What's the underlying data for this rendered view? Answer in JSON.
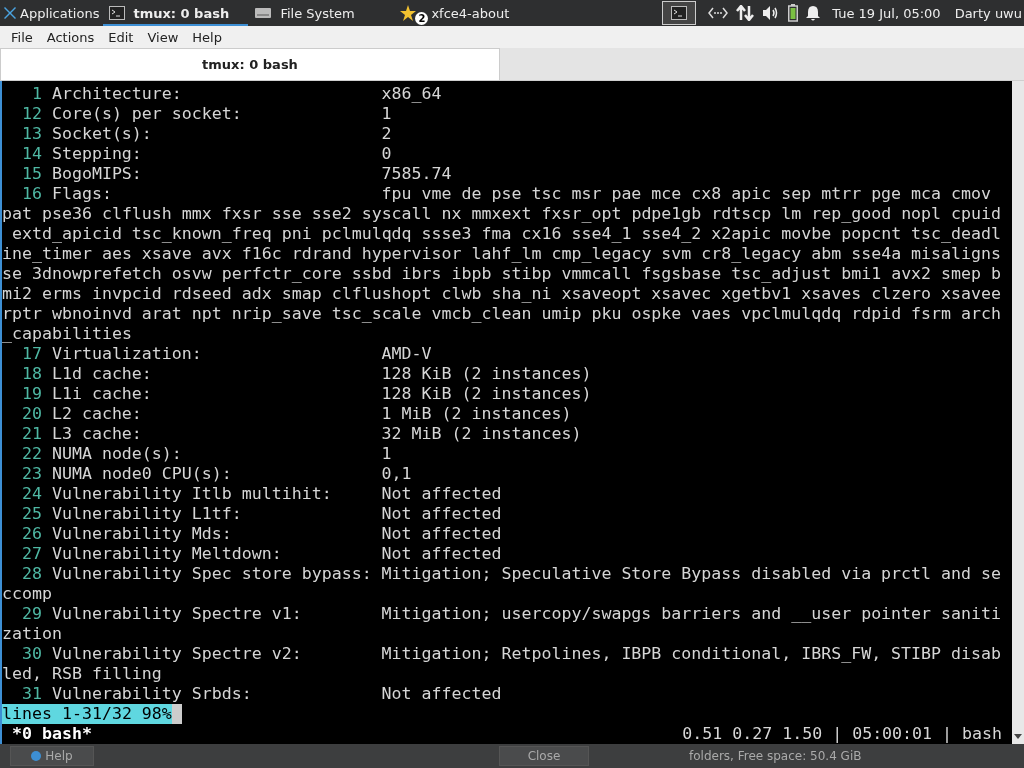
{
  "panel": {
    "apps_menu": "Applications",
    "tasks": [
      {
        "label": "tmux: 0 bash",
        "selected": true
      },
      {
        "label": "File System",
        "selected": false
      },
      {
        "label": "xfce4-about",
        "badge": "2",
        "selected": false
      }
    ],
    "clock": "Tue 19 Jul, 05:00",
    "user": "Darty uwu"
  },
  "menubar": [
    "File",
    "Actions",
    "Edit",
    "View",
    "Help"
  ],
  "tabs": [
    {
      "label": "tmux: 0 bash",
      "selected": true
    }
  ],
  "terminal": {
    "lines": [
      {
        "kind": "entry",
        "num": "1",
        "label": "Architecture:",
        "value": "x86_64"
      },
      {
        "kind": "entry",
        "num": "12",
        "label": "Core(s) per socket:",
        "value": "1"
      },
      {
        "kind": "entry",
        "num": "13",
        "label": "Socket(s):",
        "value": "2"
      },
      {
        "kind": "entry",
        "num": "14",
        "label": "Stepping:",
        "value": "0"
      },
      {
        "kind": "entry",
        "num": "15",
        "label": "BogoMIPS:",
        "value": "7585.74"
      },
      {
        "kind": "entry",
        "num": "16",
        "label": "Flags:",
        "value": "fpu vme de pse tsc msr pae mce cx8 apic sep mtrr pge mca cmov"
      },
      {
        "kind": "wrap",
        "text": "pat pse36 clflush mmx fxsr sse sse2 syscall nx mmxext fxsr_opt pdpe1gb rdtscp lm rep_good nopl cpuid"
      },
      {
        "kind": "wrap",
        "text": " extd_apicid tsc_known_freq pni pclmulqdq ssse3 fma cx16 sse4_1 sse4_2 x2apic movbe popcnt tsc_deadl"
      },
      {
        "kind": "wrap",
        "text": "ine_timer aes xsave avx f16c rdrand hypervisor lahf_lm cmp_legacy svm cr8_legacy abm sse4a misaligns"
      },
      {
        "kind": "wrap",
        "text": "se 3dnowprefetch osvw perfctr_core ssbd ibrs ibpb stibp vmmcall fsgsbase tsc_adjust bmi1 avx2 smep b"
      },
      {
        "kind": "wrap",
        "text": "mi2 erms invpcid rdseed adx smap clflushopt clwb sha_ni xsaveopt xsavec xgetbv1 xsaves clzero xsavee"
      },
      {
        "kind": "wrap",
        "text": "rptr wbnoinvd arat npt nrip_save tsc_scale vmcb_clean umip pku ospke vaes vpclmulqdq rdpid fsrm arch"
      },
      {
        "kind": "wrap",
        "text": "_capabilities"
      },
      {
        "kind": "entry",
        "num": "17",
        "label": "Virtualization:",
        "value": "AMD-V"
      },
      {
        "kind": "entry",
        "num": "18",
        "label": "L1d cache:",
        "value": "128 KiB (2 instances)"
      },
      {
        "kind": "entry",
        "num": "19",
        "label": "L1i cache:",
        "value": "128 KiB (2 instances)"
      },
      {
        "kind": "entry",
        "num": "20",
        "label": "L2 cache:",
        "value": "1 MiB (2 instances)"
      },
      {
        "kind": "entry",
        "num": "21",
        "label": "L3 cache:",
        "value": "32 MiB (2 instances)"
      },
      {
        "kind": "entry",
        "num": "22",
        "label": "NUMA node(s):",
        "value": "1"
      },
      {
        "kind": "entry",
        "num": "23",
        "label": "NUMA node0 CPU(s):",
        "value": "0,1"
      },
      {
        "kind": "entry",
        "num": "24",
        "label": "Vulnerability Itlb multihit:",
        "value": "Not affected"
      },
      {
        "kind": "entry",
        "num": "25",
        "label": "Vulnerability L1tf:",
        "value": "Not affected"
      },
      {
        "kind": "entry",
        "num": "26",
        "label": "Vulnerability Mds:",
        "value": "Not affected"
      },
      {
        "kind": "entry",
        "num": "27",
        "label": "Vulnerability Meltdown:",
        "value": "Not affected"
      },
      {
        "kind": "entry",
        "num": "28",
        "label": "Vulnerability Spec store bypass:",
        "value": "Mitigation; Speculative Store Bypass disabled via prctl and se"
      },
      {
        "kind": "wrap",
        "text": "ccomp"
      },
      {
        "kind": "entry",
        "num": "29",
        "label": "Vulnerability Spectre v1:",
        "value": "Mitigation; usercopy/swapgs barriers and __user pointer saniti"
      },
      {
        "kind": "wrap",
        "text": "zation"
      },
      {
        "kind": "entry",
        "num": "30",
        "label": "Vulnerability Spectre v2:",
        "value": "Mitigation; Retpolines, IBPB conditional, IBRS_FW, STIBP disab"
      },
      {
        "kind": "wrap",
        "text": "led, RSB filling"
      },
      {
        "kind": "entry",
        "num": "31",
        "label": "Vulnerability Srbds:",
        "value": "Not affected"
      }
    ]
  },
  "tmux": {
    "mode_indicator": "lines 1-31/32 98%",
    "window": "*0 bash*",
    "status_right": "0.51 0.27 1.50 | 05:00:01 | bash"
  },
  "behind": {
    "help_button": "Help",
    "close_button": "Close",
    "status": "folders, Free space: 50.4 GiB"
  }
}
